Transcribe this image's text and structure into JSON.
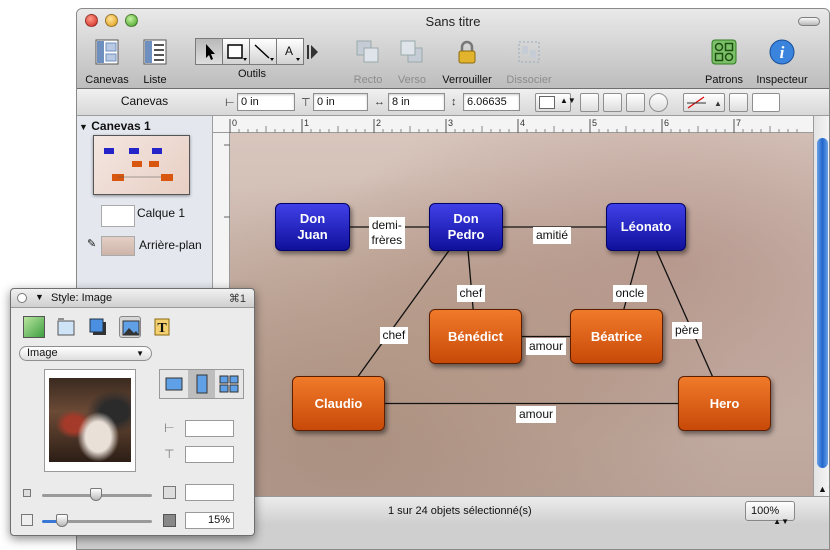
{
  "window": {
    "title": "Sans titre"
  },
  "toolbar": {
    "canevas_label": "Canevas",
    "liste_label": "Liste",
    "outils_label": "Outils",
    "text_tool_glyph": "A",
    "recto_label": "Recto",
    "verso_label": "Verso",
    "verrouiller_label": "Verrouiller",
    "dissocier_label": "Dissocier",
    "patrons_label": "Patrons",
    "inspecteur_label": "Inspecteur",
    "inspecteur_glyph": "i"
  },
  "sidebar": {
    "header": "Canevas",
    "canvas_item": "Canevas 1",
    "layers": [
      {
        "label": "Calque 1"
      },
      {
        "label": "Arrière-plan"
      }
    ]
  },
  "inspector_bar": {
    "x_value": "0 in",
    "y_value": "0 in",
    "width_value": "8 in",
    "height_value": "6.06635"
  },
  "ruler": {
    "top_ticks": [
      "0",
      "1",
      "2",
      "3",
      "4",
      "5",
      "6",
      "7"
    ]
  },
  "diagram": {
    "nodes": [
      {
        "id": "don-juan",
        "label": "Don\nJuan",
        "style": "blue"
      },
      {
        "id": "don-pedro",
        "label": "Don\nPedro",
        "style": "blue"
      },
      {
        "id": "leonato",
        "label": "Léonato",
        "style": "blue"
      },
      {
        "id": "benedict",
        "label": "Bénédict",
        "style": "orange"
      },
      {
        "id": "beatrice",
        "label": "Béatrice",
        "style": "orange"
      },
      {
        "id": "claudio",
        "label": "Claudio",
        "style": "orange"
      },
      {
        "id": "hero",
        "label": "Hero",
        "style": "orange"
      }
    ],
    "edges": [
      {
        "from": "don-juan",
        "to": "don-pedro",
        "label": "demi-\nfrères"
      },
      {
        "from": "don-pedro",
        "to": "leonato",
        "label": "amitié"
      },
      {
        "from": "don-pedro",
        "to": "benedict",
        "label": "chef"
      },
      {
        "from": "don-pedro",
        "to": "claudio",
        "label": "chef"
      },
      {
        "from": "leonato",
        "to": "beatrice",
        "label": "oncle"
      },
      {
        "from": "leonato",
        "to": "hero",
        "label": "père"
      },
      {
        "from": "benedict",
        "to": "beatrice",
        "label": "amour"
      },
      {
        "from": "claudio",
        "to": "hero",
        "label": "amour"
      }
    ],
    "colors": {
      "blue": "#1a1ab8",
      "orange": "#d9560f"
    }
  },
  "status": {
    "text": "1 sur 24 objets sélectionné(s)",
    "zoom": "100%"
  },
  "panel": {
    "title": "Style: Image",
    "shortcut": "⌘1",
    "type_select": "Image",
    "text_tool_glyph": "T",
    "opacity_value": "15%"
  }
}
